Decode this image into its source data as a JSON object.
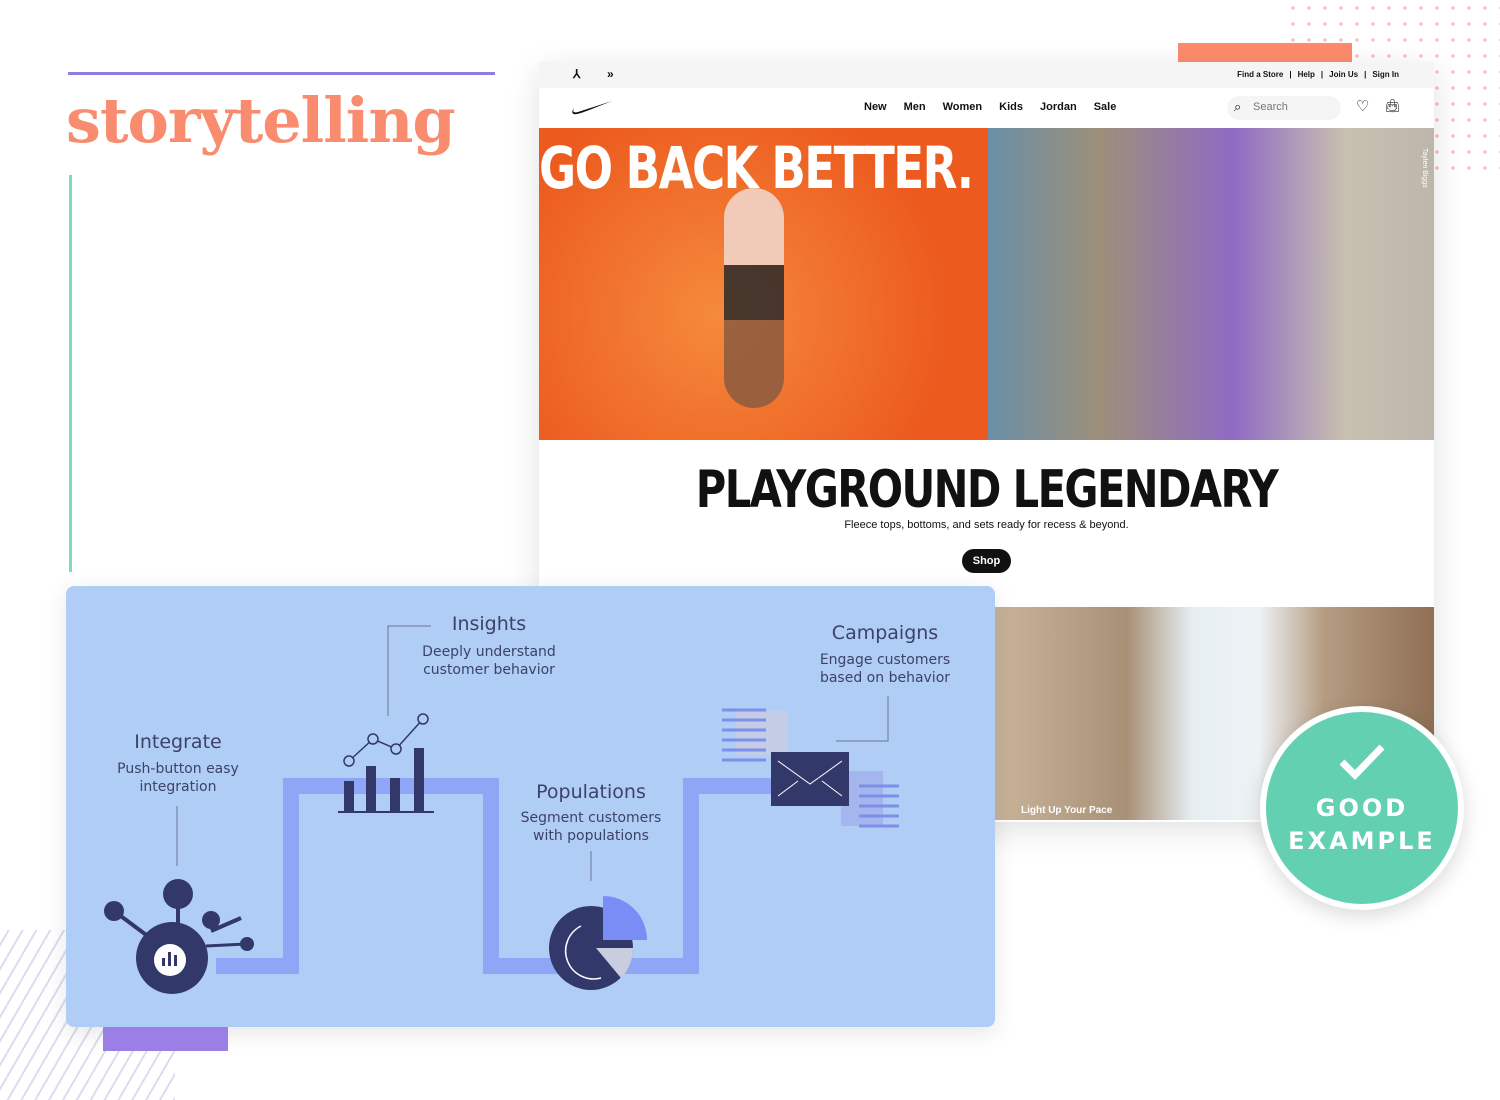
{
  "heading": "storytelling",
  "nike": {
    "utility_links": [
      "Find a Store",
      "|",
      "Help",
      "|",
      "Join Us",
      "|",
      "Sign In"
    ],
    "nav": [
      "New",
      "Men",
      "Women",
      "Kids",
      "Jordan",
      "Sale"
    ],
    "search_placeholder": "Search",
    "hero_headline": "GO BACK BETTER.",
    "photo_credit": "Taylen Biggs",
    "section_title": "PLAYGROUND LEGENDARY",
    "section_subtitle": "Fleece tops, bottoms, and sets ready for recess & beyond.",
    "shop_label": "Shop",
    "running_caption": "Light Up Your Pace"
  },
  "diagram": {
    "integrate": {
      "title": "Integrate",
      "line1": "Push-button easy",
      "line2": "integration"
    },
    "insights": {
      "title": "Insights",
      "line1": "Deeply understand",
      "line2": "customer behavior"
    },
    "populations": {
      "title": "Populations",
      "line1": "Segment customers",
      "line2": "with populations"
    },
    "campaigns": {
      "title": "Campaigns",
      "line1": "Engage customers",
      "line2": "based on behavior"
    }
  },
  "badge": {
    "line1": "GOOD",
    "line2": "EXAMPLE",
    "icon": "check-icon",
    "color": "#63d0b2"
  },
  "colors": {
    "accent_coral": "#f98c6e",
    "accent_purple": "#8c7fe0",
    "accent_teal": "#7fd8c4"
  }
}
